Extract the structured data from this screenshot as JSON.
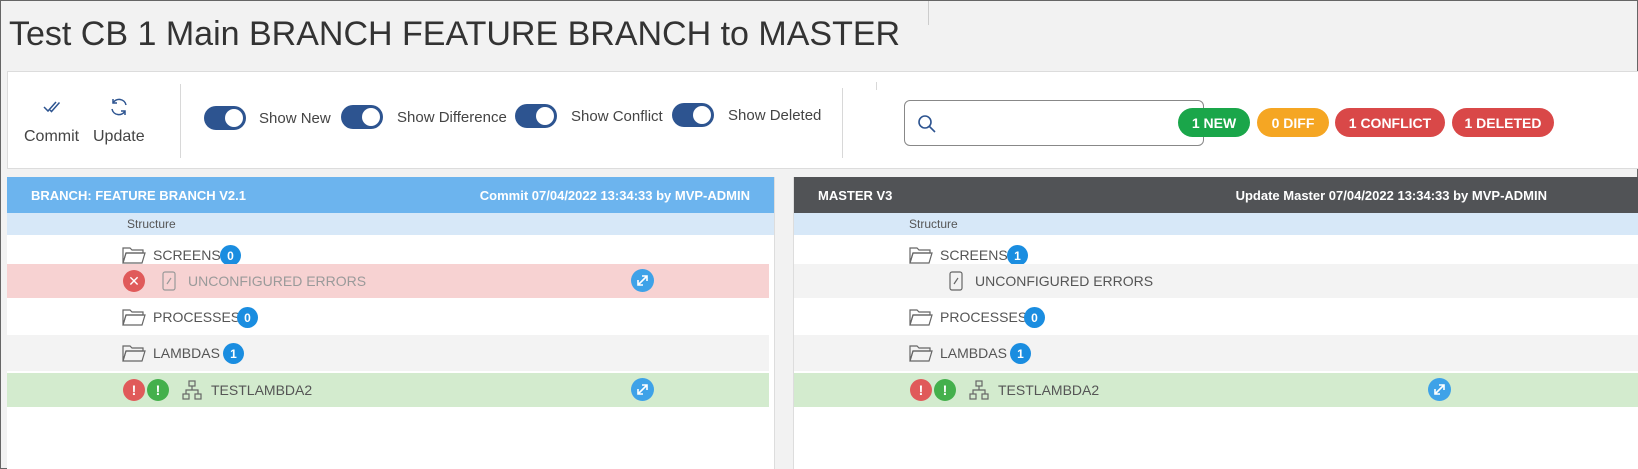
{
  "page": {
    "title": "Test CB 1 Main BRANCH FEATURE BRANCH to MASTER"
  },
  "toolbar": {
    "commit_label": "Commit",
    "update_label": "Update",
    "toggles": [
      {
        "label": "Show New",
        "on": true
      },
      {
        "label": "Show Difference",
        "on": true
      },
      {
        "label": "Show Conflict",
        "on": true
      },
      {
        "label": "Show Deleted",
        "on": true
      }
    ],
    "search": {
      "placeholder": "",
      "value": ""
    },
    "badges": {
      "new": {
        "label": "1 NEW",
        "color": "#1aa64a"
      },
      "diff": {
        "label": "0 DIFF",
        "color": "#f5a623"
      },
      "conflict": {
        "label": "1 CONFLICT",
        "color": "#d94848"
      },
      "deleted": {
        "label": "1 DELETED",
        "color": "#d94848"
      }
    }
  },
  "left_panel": {
    "header_color": "#6cb4ee",
    "name": "BRANCH: FEATURE BRANCH V2.1",
    "meta": "Commit  07/04/2022 13:34:33 by MVP-ADMIN",
    "structure_label": "Structure",
    "rows": {
      "screens": {
        "label": "SCREENS",
        "count": "0"
      },
      "unconfigured": {
        "label": "UNCONFIGURED ERRORS",
        "status_icon": "x-icon"
      },
      "processes": {
        "label": "PROCESSES",
        "count": "0"
      },
      "lambdas": {
        "label": "LAMBDAS",
        "count": "1"
      },
      "testlambda": {
        "label": "TESTLAMBDA2"
      }
    }
  },
  "right_panel": {
    "header_color": "#515356",
    "name": "MASTER V3",
    "meta": "Update Master  07/04/2022 13:34:33 by MVP-ADMIN",
    "structure_label": "Structure",
    "rows": {
      "screens": {
        "label": "SCREENS",
        "count": "1"
      },
      "unconfigured": {
        "label": "UNCONFIGURED ERRORS"
      },
      "processes": {
        "label": "PROCESSES",
        "count": "0"
      },
      "lambdas": {
        "label": "LAMBDAS",
        "count": "1"
      },
      "testlambda": {
        "label": "TESTLAMBDA2"
      }
    }
  },
  "colors": {
    "deleted_row": "#f7d2d2",
    "new_row": "#d3ebce",
    "alt_row": "#f3f3f3",
    "red": "#e05a5a",
    "green": "#44b04c"
  }
}
